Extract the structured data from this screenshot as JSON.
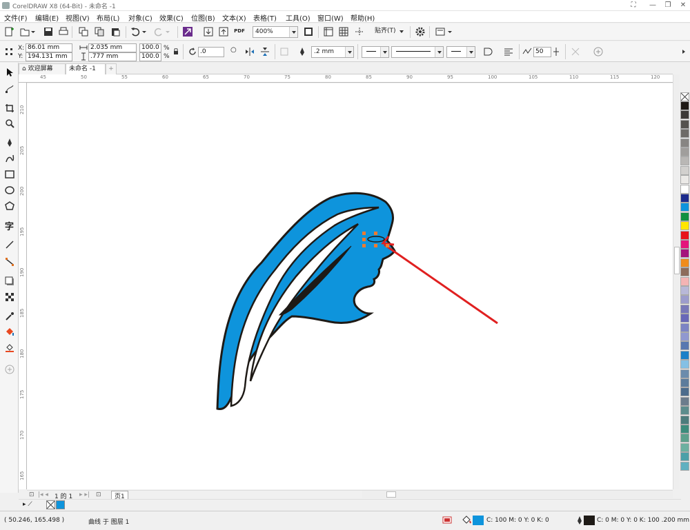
{
  "app": {
    "title": "CorelDRAW X8 (64-Bit) - 未命名 -1"
  },
  "menu": [
    "文件(F)",
    "编辑(E)",
    "视图(V)",
    "布局(L)",
    "对象(C)",
    "效果(C)",
    "位图(B)",
    "文本(X)",
    "表格(T)",
    "工具(O)",
    "窗口(W)",
    "帮助(H)"
  ],
  "toolbar": {
    "zoom": "400%",
    "snap_label": "贴齐(T)",
    "pdf_label": "PDF"
  },
  "props": {
    "x_label": "X:",
    "x": "86.01 mm",
    "y_label": "Y:",
    "y": "194.131 mm",
    "w": "2.035 mm",
    "h": ".777 mm",
    "sx": "100.0",
    "sy": "100.0",
    "pct": "%",
    "rotation": ".0",
    "outline": ".2 mm",
    "smooth": "50"
  },
  "tabs": {
    "welcome": "欢迎屏幕",
    "doc": "未命名 -1"
  },
  "ruler": {
    "h": [
      "45",
      "50",
      "55",
      "60",
      "65",
      "70",
      "75",
      "80",
      "85",
      "90",
      "95",
      "100",
      "105",
      "110",
      "115",
      "120"
    ],
    "v": [
      "210",
      "205",
      "200",
      "195",
      "190",
      "185",
      "180",
      "175",
      "170",
      "165"
    ]
  },
  "pagenav": {
    "pos": "1 的 1",
    "page": "页1"
  },
  "status": {
    "coords": "( 50.246, 165.498 )",
    "object": "曲线 于 图层 1",
    "fill_text": "C: 100 M: 0 Y: 0 K: 0",
    "outline_text": "C: 0 M: 0 Y: 0 K: 100  .200 mm"
  },
  "colors": {
    "fill": "#0e94dc",
    "outline": "#1e1a16",
    "arrow": "#e02020",
    "handle": "#ee7a30"
  },
  "palette": [
    "#1e1a16",
    "#3c3a38",
    "#55524f",
    "#6e6b68",
    "#878583",
    "#a09e9c",
    "#b9b7b5",
    "#d2d0ce",
    "#ebe9e7",
    "#ffffff",
    "#1c2b8c",
    "#0e94dc",
    "#109040",
    "#ffe600",
    "#e8141a",
    "#e4147c",
    "#a4147c",
    "#f08c1c",
    "#8c6c5c",
    "#f4b4b4",
    "#b8b8d8",
    "#9c9ccc",
    "#7878b8",
    "#6868b8",
    "#7c84c4",
    "#9098d0",
    "#5878b0",
    "#1c80c8",
    "#84c0e4",
    "#6c8cac",
    "#5c7c9c",
    "#4c6c8c",
    "#6c7c8c",
    "#5c8c8c",
    "#4c7c7c",
    "#3c8c7c",
    "#5ca08c",
    "#6cb0a0",
    "#4ca0a8",
    "#60b0c0"
  ]
}
